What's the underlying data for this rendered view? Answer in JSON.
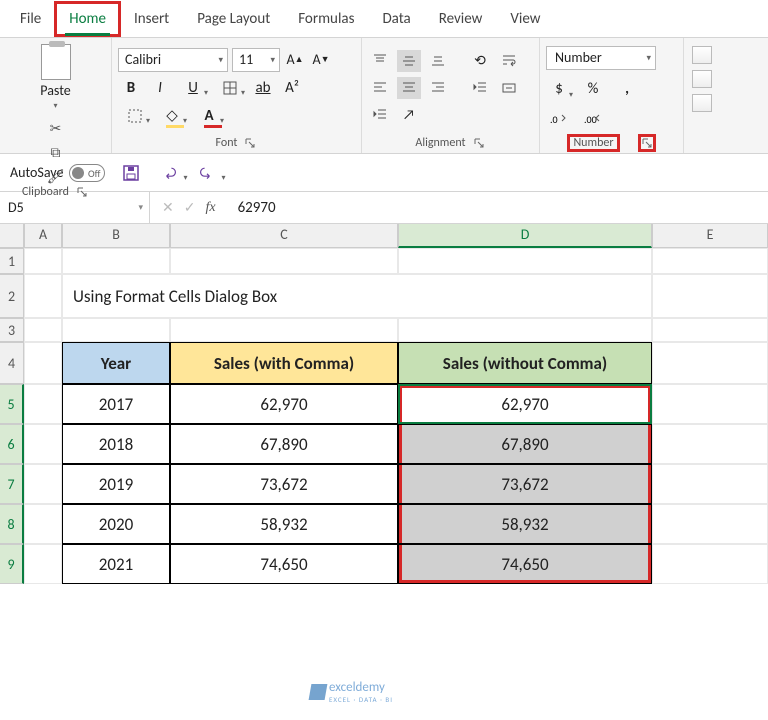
{
  "tabs": {
    "file": "File",
    "home": "Home",
    "insert": "Insert",
    "pagelayout": "Page Layout",
    "formulas": "Formulas",
    "data": "Data",
    "review": "Review",
    "view": "View"
  },
  "ribbon": {
    "clipboard": {
      "paste": "Paste",
      "label": "Clipboard"
    },
    "font": {
      "name": "Calibri",
      "size": "11",
      "label": "Font",
      "bold": "B",
      "italic": "I",
      "underline": "U"
    },
    "alignment": {
      "label": "Alignment"
    },
    "number": {
      "format": "Number",
      "label": "Number",
      "currency": "$",
      "percent": "%",
      "comma": ",",
      "accounting": "⁹"
    }
  },
  "qat": {
    "autosave": "AutoSave",
    "autosave_state": "Off"
  },
  "namebox": "D5",
  "formula": "62970",
  "columns": [
    "A",
    "B",
    "C",
    "D",
    "E"
  ],
  "rows": [
    "1",
    "2",
    "3",
    "4",
    "5",
    "6",
    "7",
    "8",
    "9"
  ],
  "title": "Using Format Cells Dialog Box",
  "headers": {
    "year": "Year",
    "withc": "Sales (with Comma)",
    "withoutc": "Sales (without Comma)"
  },
  "table": [
    {
      "year": "2017",
      "withc": "62,970",
      "withoutc": "62,970"
    },
    {
      "year": "2018",
      "withc": "67,890",
      "withoutc": "67,890"
    },
    {
      "year": "2019",
      "withc": "73,672",
      "withoutc": "73,672"
    },
    {
      "year": "2020",
      "withc": "58,932",
      "withoutc": "58,932"
    },
    {
      "year": "2021",
      "withc": "74,650",
      "withoutc": "74,650"
    }
  ],
  "watermark": {
    "brand": "exceldemy",
    "tag": "EXCEL · DATA · BI"
  }
}
